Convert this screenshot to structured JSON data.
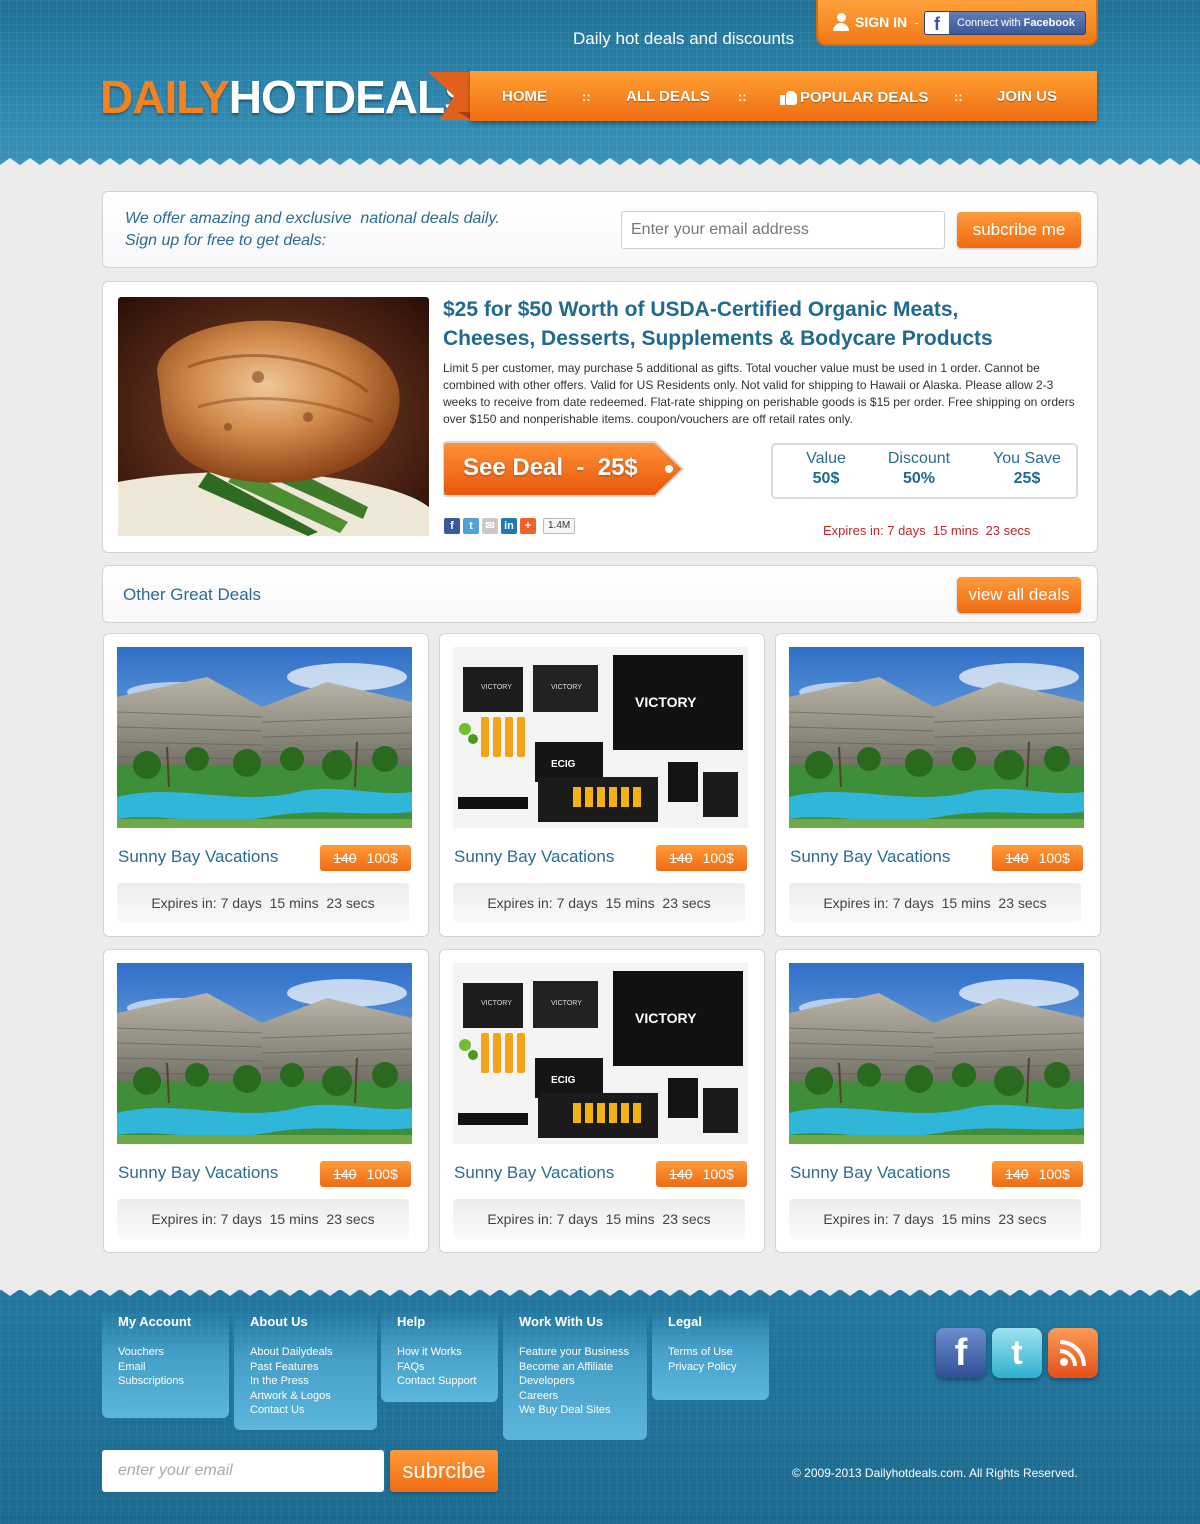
{
  "header": {
    "tagline": "Daily hot deals and discounts",
    "signin_label": "SIGN IN",
    "signin_sep": "-",
    "fb_prefix": "Connect with",
    "fb_brand": "Facebook",
    "logo_part1": "DAILY",
    "logo_part2": "HOTDEALS",
    "nav": {
      "home": "HOME",
      "all_deals": "ALL DEALS",
      "popular": "POPULAR DEALS",
      "join": "JOIN US",
      "sep": "::"
    }
  },
  "subscribe": {
    "line1": "We offer amazing and exclusive  national deals daily.",
    "line2": "Sign up for free to get deals:",
    "placeholder": "Enter your email address",
    "button": "subcribe me"
  },
  "featured": {
    "title_line1": "$25 for $50 Worth of USDA-Certified Organic Meats,",
    "title_line2": "Cheeses, Desserts, Supplements & Bodycare Products",
    "description": "Limit 5 per customer, may purchase 5 additional as gifts. Total voucher value must be used in 1 order. Cannot be combined with other offers. Valid for US Residents only. Not valid for shipping to Hawaii or Alaska. Please allow 2-3 weeks to receive from date redeemed. Flat-rate shipping on perishable goods is $15 per order. Free shipping on orders over $150 and nonperishable items. coupon/vouchers are off retail rates only.",
    "cta": "See Deal  -  25$",
    "stats": {
      "value_label": "Value",
      "value": "50$",
      "discount_label": "Discount",
      "discount": "50%",
      "save_label": "You Save",
      "save": "25$"
    },
    "share_count": "1.4M",
    "expires": "Expires in: 7 days  15 mins  23 secs"
  },
  "other": {
    "title": "Other Great Deals",
    "button": "view all deals"
  },
  "deals": [
    {
      "title": "Sunny Bay Vacations",
      "old_price": "140",
      "new_price": "100$",
      "expires": "Expires in: 7 days  15 mins  23 secs",
      "image": "resort"
    },
    {
      "title": "Sunny Bay Vacations",
      "old_price": "140",
      "new_price": "100$",
      "expires": "Expires in: 7 days  15 mins  23 secs",
      "image": "ecig"
    },
    {
      "title": "Sunny Bay Vacations",
      "old_price": "140",
      "new_price": "100$",
      "expires": "Expires in: 7 days  15 mins  23 secs",
      "image": "resort"
    },
    {
      "title": "Sunny Bay Vacations",
      "old_price": "140",
      "new_price": "100$",
      "expires": "Expires in: 7 days  15 mins  23 secs",
      "image": "resort"
    },
    {
      "title": "Sunny Bay Vacations",
      "old_price": "140",
      "new_price": "100$",
      "expires": "Expires in: 7 days  15 mins  23 secs",
      "image": "ecig"
    },
    {
      "title": "Sunny Bay Vacations",
      "old_price": "140",
      "new_price": "100$",
      "expires": "Expires in: 7 days  15 mins  23 secs",
      "image": "resort"
    }
  ],
  "footer": {
    "columns": [
      {
        "heading": "My Account",
        "links": [
          "Vouchers",
          "Email Subscriptions"
        ]
      },
      {
        "heading": "About Us",
        "links": [
          "About Dailydeals",
          "Past Features",
          "In the Press",
          "Artwork & Logos",
          "Contact Us"
        ]
      },
      {
        "heading": "Help",
        "links": [
          "How it Works",
          "FAQs",
          "Contact Support"
        ]
      },
      {
        "heading": "Work With Us",
        "links": [
          "Feature your Business",
          "Become an Affiliate",
          "Developers",
          "Careers",
          "We Buy Deal Sites"
        ]
      },
      {
        "heading": "Legal",
        "links": [
          "Terms of Use",
          "Privacy Policy"
        ]
      }
    ],
    "email_placeholder": "enter your email",
    "subscribe_button": "subrcibe",
    "copyright": "© 2009-2013 Dailyhotdeals.com. All Rights Reserved."
  },
  "colors": {
    "header_blue": "#2d86ae",
    "accent_orange": "#f58220",
    "title_blue": "#1f6a8e",
    "expire_red": "#c0272d"
  }
}
